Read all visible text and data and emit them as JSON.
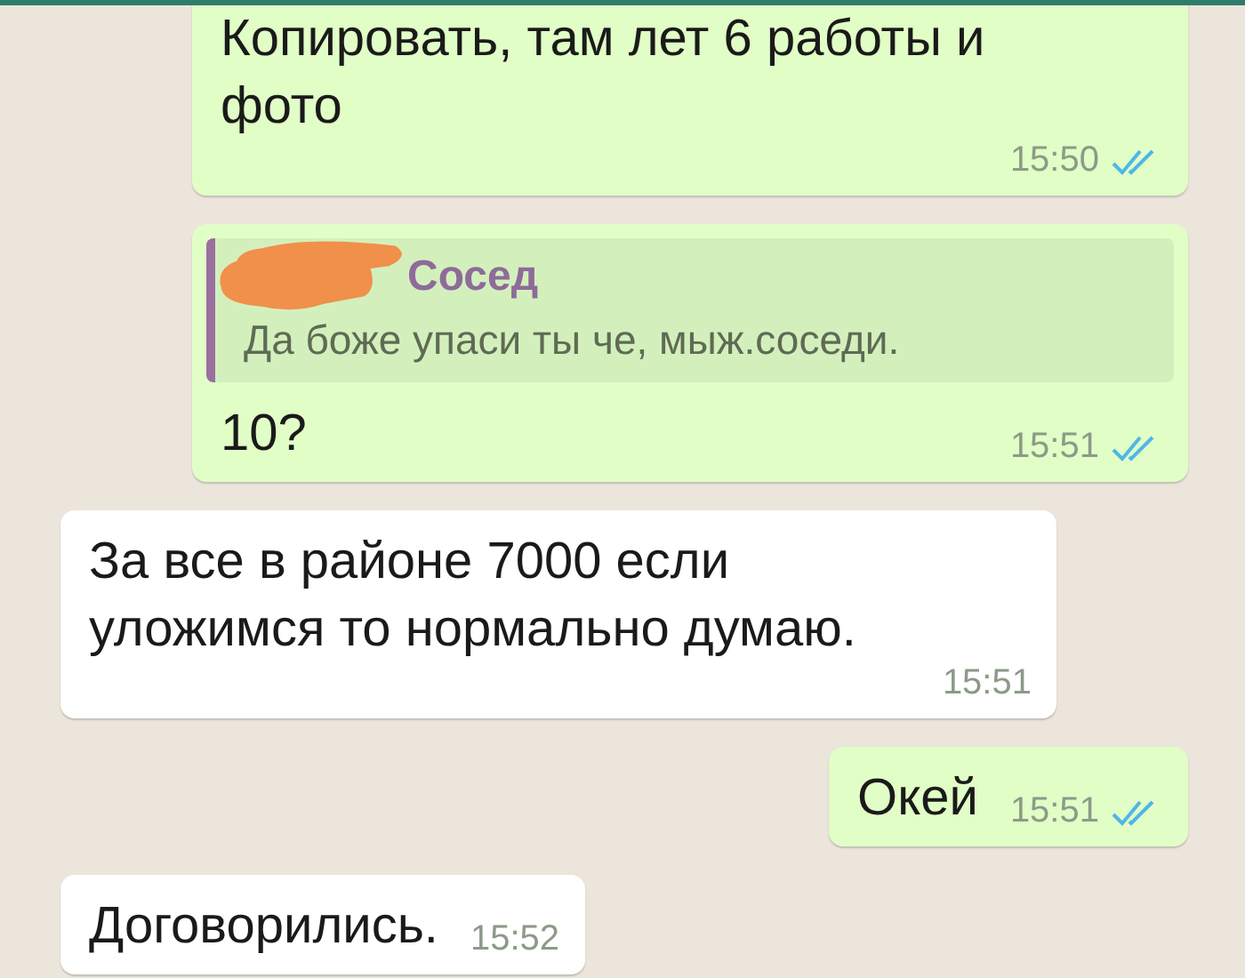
{
  "messages": [
    {
      "kind": "outgoing",
      "text": "Копировать, там лет 6 работы и фото",
      "time": "15:50",
      "read": true
    },
    {
      "kind": "outgoing",
      "quote": {
        "author": "Сосед",
        "text": "Да боже упаси ты че, мыж.соседи.",
        "redacted": true
      },
      "text": "10?",
      "time": "15:51",
      "read": true
    },
    {
      "kind": "incoming",
      "text": "За все в районе 7000 если уложимся то нормально думаю.",
      "time": "15:51"
    },
    {
      "kind": "outgoing",
      "text": "Окей",
      "time": "15:51",
      "read": true
    },
    {
      "kind": "incoming",
      "text": "Договорились.",
      "time": "15:52"
    }
  ]
}
